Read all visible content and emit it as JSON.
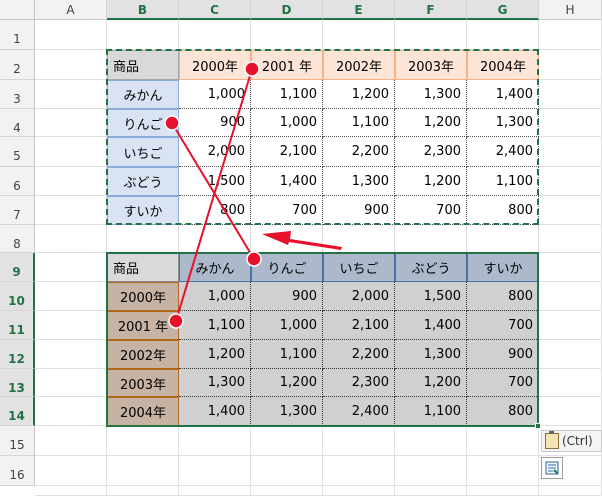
{
  "columns": [
    "A",
    "B",
    "C",
    "D",
    "E",
    "F",
    "G",
    "H"
  ],
  "rows": [
    "1",
    "2",
    "3",
    "4",
    "5",
    "6",
    "7",
    "8",
    "9",
    "10",
    "11",
    "12",
    "13",
    "14",
    "15",
    "16"
  ],
  "source_table": {
    "corner": "商品",
    "years": [
      "2000年",
      "2001 年",
      "2002年",
      "2003年",
      "2004年"
    ],
    "rows": [
      {
        "name": "みかん",
        "values": [
          "1,000",
          "1,100",
          "1,200",
          "1,300",
          "1,400"
        ]
      },
      {
        "name": "りんご",
        "values": [
          "900",
          "1,000",
          "1,100",
          "1,200",
          "1,300"
        ]
      },
      {
        "name": "いちご",
        "values": [
          "2,000",
          "2,100",
          "2,200",
          "2,300",
          "2,400"
        ]
      },
      {
        "name": "ぶどう",
        "values": [
          "1,500",
          "1,400",
          "1,300",
          "1,200",
          "1,100"
        ]
      },
      {
        "name": "すいか",
        "values": [
          "800",
          "700",
          "900",
          "700",
          "800"
        ]
      }
    ]
  },
  "transposed_table": {
    "corner": "商品",
    "fruits": [
      "みかん",
      "りんご",
      "いちご",
      "ぶどう",
      "すいか"
    ],
    "rows": [
      {
        "year": "2000年",
        "values": [
          "1,000",
          "900",
          "2,000",
          "1,500",
          "800"
        ]
      },
      {
        "year": "2001 年",
        "values": [
          "1,100",
          "1,000",
          "2,100",
          "1,400",
          "700"
        ]
      },
      {
        "year": "2002年",
        "values": [
          "1,200",
          "1,100",
          "2,200",
          "1,300",
          "900"
        ]
      },
      {
        "year": "2003年",
        "values": [
          "1,300",
          "1,200",
          "2,300",
          "1,200",
          "700"
        ]
      },
      {
        "year": "2004年",
        "values": [
          "1,400",
          "1,300",
          "2,400",
          "1,100",
          "800"
        ]
      }
    ]
  },
  "paste_options": {
    "label": "(Ctrl)",
    "paste_icon": "clipboard-icon",
    "quick_analysis_icon": "quick-analysis-icon"
  },
  "annotation_icons": [
    "red-dot-marker",
    "red-arrow"
  ],
  "colors": {
    "header_orange_fill": "#fce4d6",
    "header_orange_border": "#f4b183",
    "header_blue_fill": "#dae3f3",
    "header_blue_border": "#8ea9db",
    "transposed_fruit_fill": "#acb9ca",
    "transposed_year_fill": "#c6b3a3",
    "transposed_body_fill": "#d0d0d0",
    "corner_fill": "#d9d9d9",
    "selection_green": "#217346",
    "annotation_red": "#e8102a"
  }
}
